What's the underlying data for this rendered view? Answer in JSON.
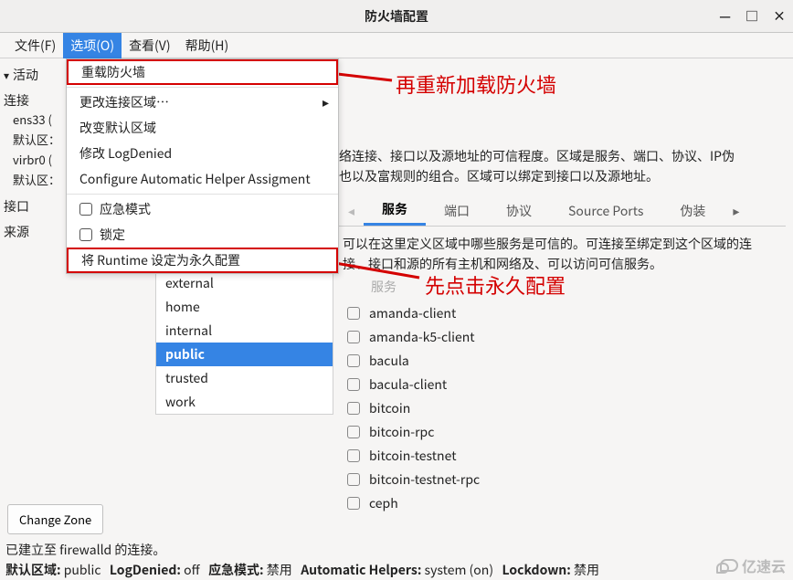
{
  "window": {
    "title": "防火墙配置",
    "min": "—",
    "max": "□",
    "close": "×"
  },
  "menubar": {
    "file": "文件(F)",
    "options": "选项(O)",
    "view": "查看(V)",
    "help": "帮助(H)"
  },
  "left": {
    "active_label": "活动",
    "connections": "连接",
    "conn1": "ens33 (",
    "conn1_zone": "默认区：",
    "conn2": "virbr0 (",
    "conn2_zone": "默认区：",
    "interfaces": "接口",
    "sources": "来源"
  },
  "dropdown": {
    "reload": "重载防火墙",
    "change_conn_zone": "更改连接区域…",
    "change_default_zone": "改变默认区域",
    "modify_logdenied": "修改 LogDenied",
    "configure_helper": "Configure Automatic Helper Assigment",
    "panic": "应急模式",
    "lockdown": "锁定",
    "runtime_to_perm": "将 Runtime 设定为永久配置"
  },
  "right_desc_l1": "络连接、接口以及源地址的可信程度。区域是服务、端口、协议、IP伪",
  "right_desc_l2": "也以及富规则的组合。区域可以绑定到接口以及源地址。",
  "tabs": {
    "services": "服务",
    "ports": "端口",
    "protocols": "协议",
    "source_ports": "Source Ports",
    "masq": "伪装"
  },
  "tab_desc_l1": "可以在这里定义区域中哪些服务是可信的。可连接至绑定到这个区域的连",
  "tab_desc_l2": "接、接口和源的所有主机和网络及、可以访问可信服务。",
  "zones": [
    "external",
    "home",
    "internal",
    "public",
    "trusted",
    "work"
  ],
  "zone_selected": "public",
  "svc_header": "服务",
  "services": [
    "amanda-client",
    "amanda-k5-client",
    "bacula",
    "bacula-client",
    "bitcoin",
    "bitcoin-rpc",
    "bitcoin-testnet",
    "bitcoin-testnet-rpc",
    "ceph"
  ],
  "change_zone_btn": "Change Zone",
  "status_connected": "已建立至 firewalld 的连接。",
  "status_bar": {
    "default_zone_label": "默认区域:",
    "default_zone_value": "public",
    "logdenied_label": "LogDenied:",
    "logdenied_value": "off",
    "panic_label": "应急模式:",
    "panic_value": "禁用",
    "helpers_label": "Automatic Helpers:",
    "helpers_value": "system (on)",
    "lockdown_label": "Lockdown:",
    "lockdown_value": "禁用"
  },
  "annotations": {
    "a1": "再重新加载防火墙",
    "a2": "先点击永久配置"
  },
  "watermark": "亿速云"
}
